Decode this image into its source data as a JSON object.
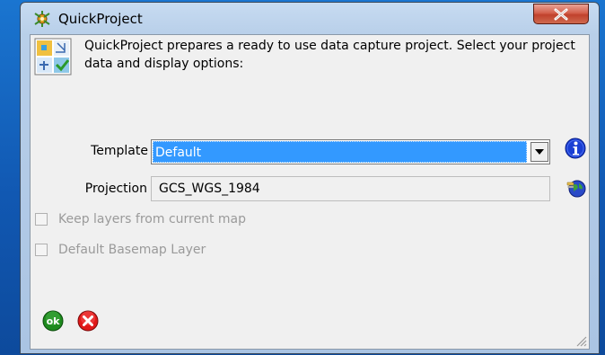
{
  "window": {
    "title": "QuickProject",
    "close_symbol": "X"
  },
  "description": "QuickProject prepares a ready to use data capture project. Select your project data and display options:",
  "template": {
    "label": "Template",
    "value": "Default"
  },
  "projection": {
    "label": "Projection",
    "value": "GCS_WGS_1984"
  },
  "options": {
    "keep_layers_label": "Keep layers from current map",
    "keep_layers_checked": false,
    "basemap_label": "Default Basemap Layer",
    "basemap_checked": false
  },
  "buttons": {
    "ok_label": "ok"
  },
  "icons": {
    "app": "quickproject-app-icon",
    "logo": "map-grid-check-icon",
    "info": "info-icon",
    "globe": "globe-icon",
    "ok": "ok-icon",
    "cancel": "cancel-icon"
  },
  "colors": {
    "selection": "#3399ff",
    "ok_green": "#1e8a1e",
    "cancel_red": "#e01818",
    "info_blue": "#1a3fd4"
  }
}
